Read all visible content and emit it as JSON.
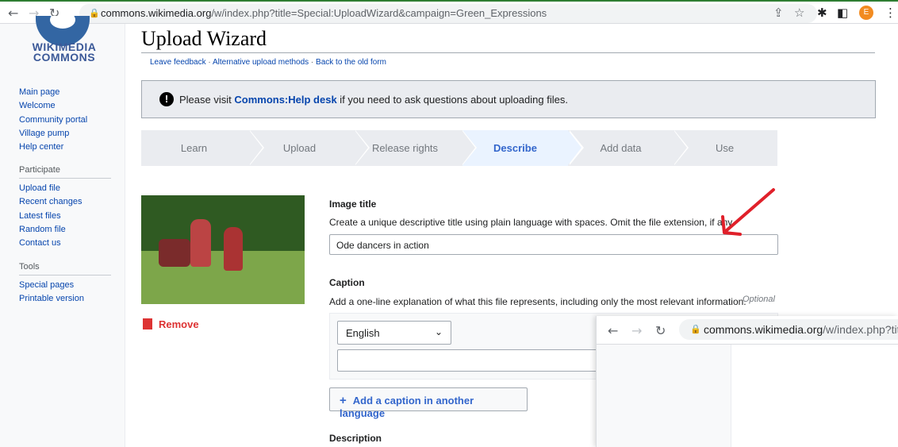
{
  "browser": {
    "url_host": "commons.wikimedia.org",
    "url_path": "/w/index.php?title=Special:UploadWizard&campaign=Green_Expressions",
    "profile_initial": "E"
  },
  "sidebar": {
    "logo": "WIKIMEDIA COMMONS",
    "main_links": [
      "Main page",
      "Welcome",
      "Community portal",
      "Village pump",
      "Help center"
    ],
    "participate_heading": "Participate",
    "participate_links": [
      "Upload file",
      "Recent changes",
      "Latest files",
      "Random file",
      "Contact us"
    ],
    "tools_heading": "Tools",
    "tools_links": [
      "Special pages",
      "Printable version"
    ]
  },
  "page": {
    "title": "Upload Wizard",
    "links": {
      "feedback": "Leave feedback",
      "sep1": " · ",
      "alt": "Alternative upload methods",
      "sep2": " · ",
      "old": "Back to the old form"
    },
    "notice": {
      "prefix": "Please visit ",
      "link": "Commons:Help desk",
      "suffix": " if you need to ask questions about uploading files."
    }
  },
  "steps": [
    "Learn",
    "Upload",
    "Release rights",
    "Describe",
    "Add data",
    "Use"
  ],
  "active_step": "Describe",
  "form": {
    "remove_label": "Remove",
    "image_title_label": "Image title",
    "image_title_help": "Create a unique descriptive title using plain language with spaces. Omit the file extension, if any.",
    "image_title_value": "Ode dancers in action",
    "caption_label": "Caption",
    "caption_help": "Add a one-line explanation of what this file represents, including only the most relevant information.",
    "caption_optional": "Optional",
    "language_selected": "English",
    "add_caption_button": "Add a caption in another language",
    "description_label": "Description"
  },
  "overlay": {
    "url_host": "commons.wikimedia.org",
    "url_path": "/w/index.php?title"
  },
  "colors": {
    "link": "#0645ad",
    "active_step": "#3366cc",
    "remove": "#dd3333",
    "annotation_arrow": "#e0202a"
  }
}
